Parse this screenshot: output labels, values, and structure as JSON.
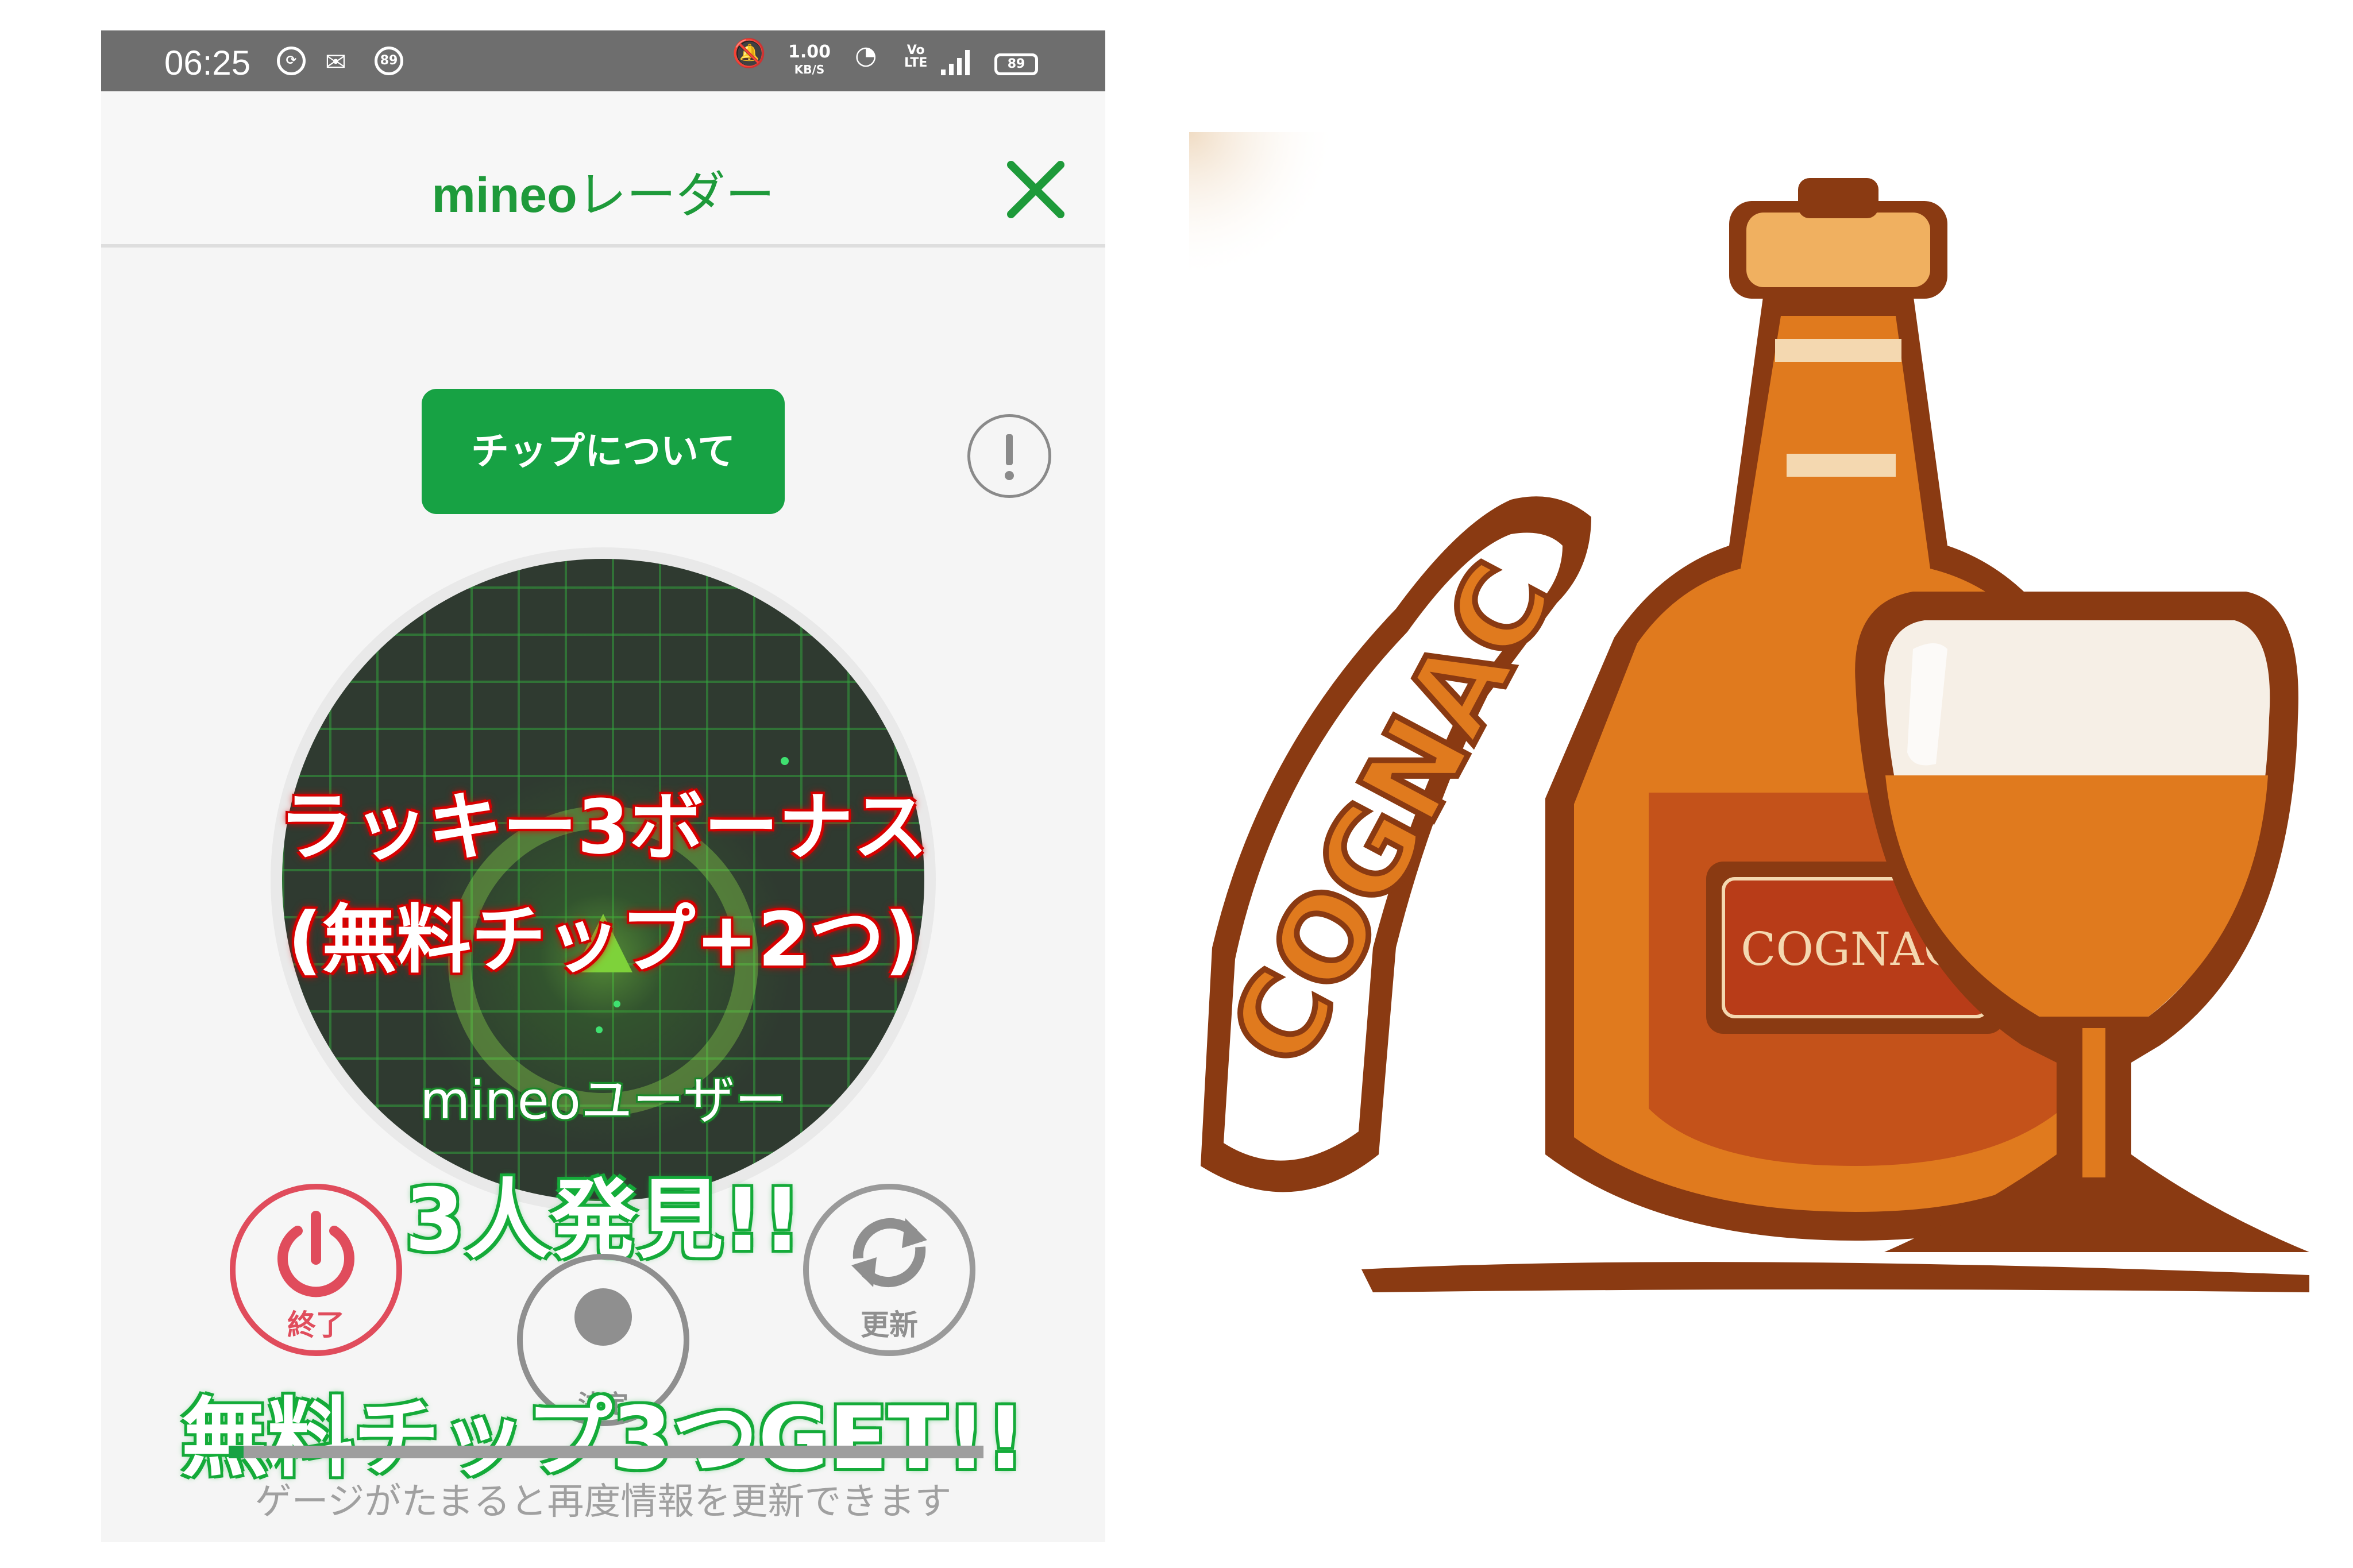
{
  "status_bar": {
    "time": "06:25",
    "left_badge": "89",
    "speed_value": "1.00",
    "speed_unit": "KB/S",
    "volte_top": "Vo",
    "volte_bottom": "LTE",
    "battery": "89"
  },
  "header": {
    "title_brand": "mineo",
    "title_suffix": "レーダー"
  },
  "chip_button_label": "チップについて",
  "overlay": {
    "bonus_line1": "ラッキー3ボーナス",
    "bonus_line2": "(無料チップ+2つ)",
    "users_label": "mineoユーザー",
    "found_count": "3人発見!!",
    "get_text": "無料チップ3つGET!!"
  },
  "controls": {
    "end_label": "終了",
    "middle_label": "決定",
    "refresh_label": "更新"
  },
  "gauge": {
    "fill_fraction": 0.02,
    "hint": "ゲージがたまると再度情報を更新できます"
  },
  "illustration": {
    "label_arc": "COGNAC",
    "bottle_label": "COGNAC"
  },
  "colors": {
    "brand_green": "#17a244",
    "end_red": "#e04c5c",
    "cognac_brown": "#8a3a12",
    "cognac_orange": "#e07a1e"
  }
}
